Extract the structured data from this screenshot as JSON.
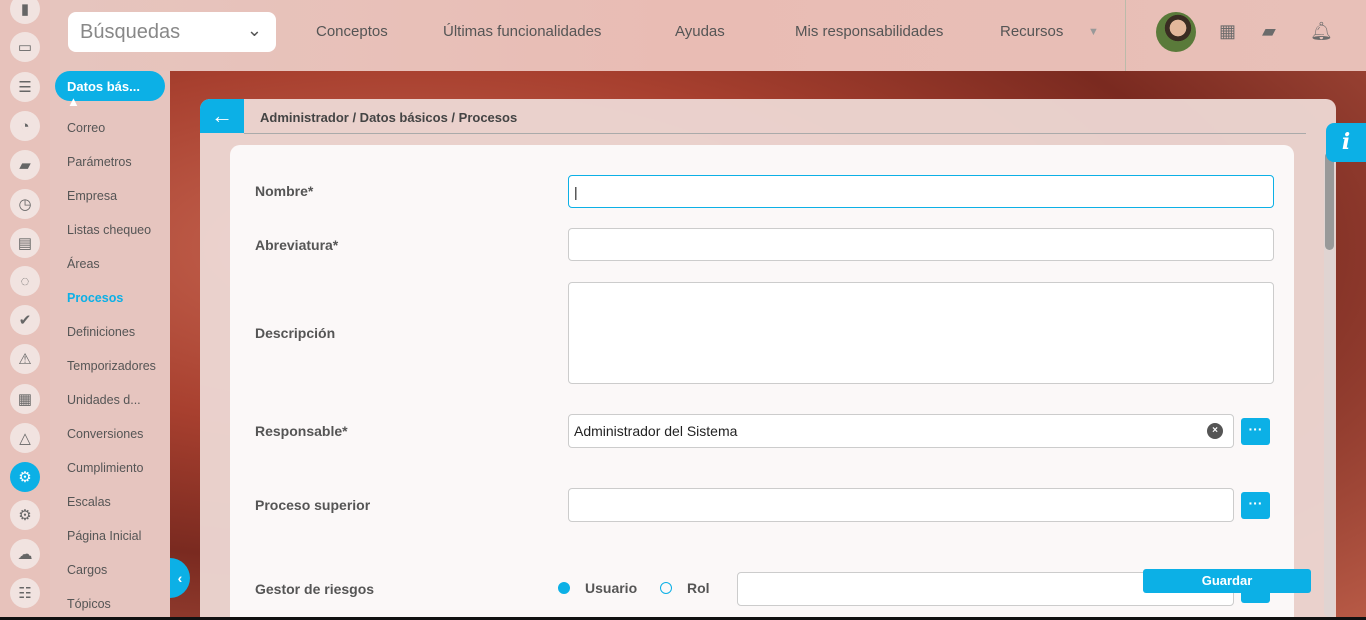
{
  "search": {
    "placeholder": "Búsquedas"
  },
  "nav": [
    "Conceptos",
    "Últimas funcionalidades",
    "Ayudas",
    "Mis responsabilidades",
    "Recursos"
  ],
  "menu": {
    "toggle": "Datos bás...",
    "items": [
      "Correo",
      "Parámetros",
      "Empresa",
      "Listas chequeo",
      "Áreas",
      "Procesos",
      "Definiciones",
      "Temporizadores",
      "Unidades d...",
      "Conversiones",
      "Cumplimiento",
      "Escalas",
      "Página Inicial",
      "Cargos",
      "Tópicos"
    ],
    "active": "Procesos"
  },
  "breadcrumb": "Administrador / Datos básicos / Procesos",
  "form": {
    "nombre": "Nombre*",
    "abreviatura": "Abreviatura*",
    "descripcion": "Descripción",
    "responsable": "Responsable*",
    "responsable_value": "Administrador del Sistema",
    "proceso_superior": "Proceso superior",
    "gestor": "Gestor de riesgos",
    "usuario": "Usuario",
    "rol": "Rol",
    "guardar": "Guardar"
  },
  "colors": {
    "accent": "#0cb0e6"
  }
}
